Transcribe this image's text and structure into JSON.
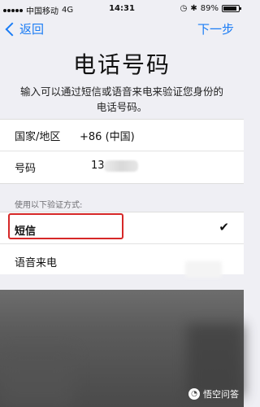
{
  "status_bar": {
    "carrier": "中国移动",
    "network": "4G",
    "time": "14:31",
    "battery": "89%",
    "battery_level": 0.89
  },
  "nav": {
    "back_label": "返回",
    "next_label": "下一步"
  },
  "page": {
    "title": "电话号码",
    "subtitle": "输入可以通过短信或语音来电来验证您身份的电话号码。"
  },
  "form": {
    "country_label": "国家/地区",
    "country_value": "+86 (中国)",
    "phone_label": "号码",
    "phone_value": "13"
  },
  "verification": {
    "section_header": "使用以下验证方式:",
    "options": [
      {
        "label": "短信",
        "selected": true
      },
      {
        "label": "语音来电",
        "selected": false
      }
    ],
    "check_mark": "✔"
  },
  "watermark": {
    "text": "悟空问答"
  },
  "colors": {
    "accent": "#1a7cf5",
    "highlight": "#d62828"
  }
}
